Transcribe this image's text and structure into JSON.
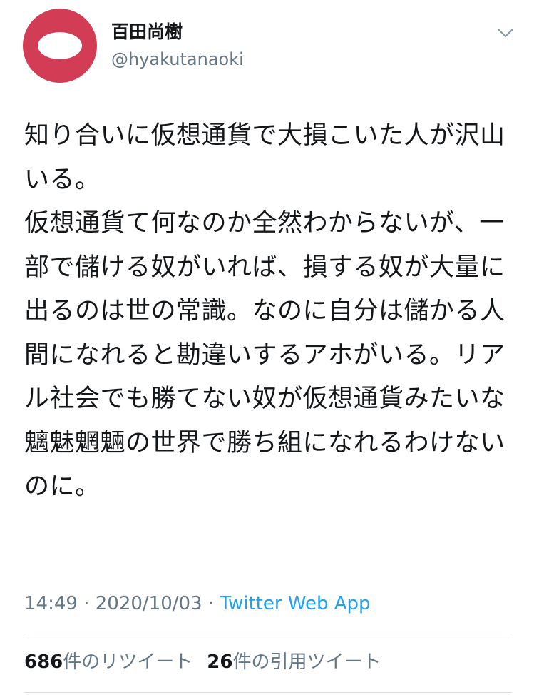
{
  "author": {
    "display_name": "百田尚樹",
    "handle": "@hyakutanaoki"
  },
  "tweet": {
    "text": "知り合いに仮想通貨で大損こいた人が沢山いる。\n仮想通貨て何なのか全然わからないが、一部で儲ける奴がいれば、損する奴が大量に出るのは世の常識。なのに自分は儲かる人間になれると勘違いするアホがいる。リアル社会でも勝てない奴が仮想通貨みたいな魑魅魍魎の世界で勝ち組になれるわけないのに。",
    "time": "14:49",
    "separator1": " · ",
    "date": "2020/10/03",
    "separator2": " · ",
    "source": "Twitter Web App"
  },
  "stats": {
    "retweets_count": "686",
    "retweets_label": "件のリツイート",
    "quotes_count": "26",
    "quotes_label": "件の引用ツイート"
  },
  "icons": {
    "caret": "chevron-down-icon",
    "avatar": "avatar-image"
  },
  "colors": {
    "avatar_bg": "#d23c55",
    "link": "#1da1f2",
    "muted": "#657786",
    "text": "#14171a"
  }
}
